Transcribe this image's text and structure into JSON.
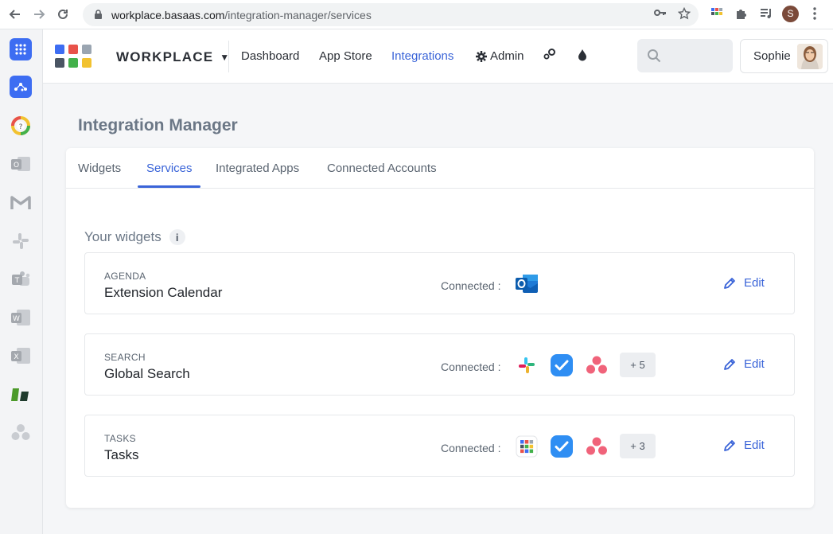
{
  "browser": {
    "url_host": "workplace.basaas.com",
    "url_path": "/integration-manager/services",
    "profile_initial": "S"
  },
  "header": {
    "brand": "WORKPLACE",
    "nav": [
      "Dashboard",
      "App Store",
      "Integrations",
      "Admin"
    ],
    "active_nav": "Integrations",
    "user_name": "Sophie"
  },
  "page": {
    "title": "Integration Manager",
    "tabs": [
      "Widgets",
      "Services",
      "Integrated Apps",
      "Connected Accounts"
    ],
    "active_tab": "Services",
    "section_title": "Your widgets",
    "info_glyph": "i",
    "connected_label": "Connected :",
    "edit_label": "Edit"
  },
  "widgets": [
    {
      "category": "AGENDA",
      "name": "Extension Calendar",
      "services": [
        "outlook-icon"
      ],
      "more": ""
    },
    {
      "category": "SEARCH",
      "name": "Global Search",
      "services": [
        "slack-icon",
        "check-app-icon",
        "asana-icon"
      ],
      "more": "+ 5"
    },
    {
      "category": "TASKS",
      "name": "Tasks",
      "services": [
        "grid-app-icon",
        "check-app-icon",
        "asana-icon"
      ],
      "more": "+ 3"
    }
  ],
  "colors": {
    "accent": "#3a64d8",
    "logo": [
      "#3d6df2",
      "#e8524a",
      "#9aa5b1",
      "#4a5563",
      "#43b14b",
      "#f2c230"
    ]
  }
}
